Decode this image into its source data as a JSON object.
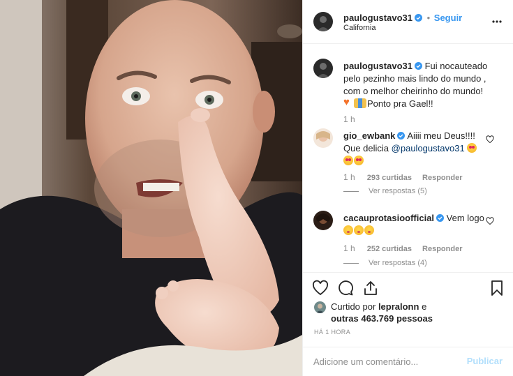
{
  "header": {
    "username": "paulogustavo31",
    "follow_label": "Seguir",
    "separator": "•",
    "location": "California"
  },
  "caption": {
    "username": "paulogustavo31",
    "text_1": "Fui nocauteado pelo pezinho mais lindo do mundo , com o melhor cheirinho do mundo!",
    "text_2": "Ponto pra Gael!!",
    "time": "1 h"
  },
  "comments": [
    {
      "username": "gio_ewbank",
      "text": "Aiiii meu Deus!!!! Que delicia",
      "mention": "@paulogustavo31",
      "time": "1 h",
      "likes": "293 curtidas",
      "reply": "Responder",
      "view_replies": "Ver respostas (5)"
    },
    {
      "username": "cacauprotasioofficial",
      "text": "Vem logo",
      "time": "1 h",
      "likes": "252 curtidas",
      "reply": "Responder",
      "view_replies": "Ver respostas (4)"
    }
  ],
  "likes": {
    "prefix": "Curtido por",
    "user": "lepralonn",
    "connector": "e",
    "others": "outras 463.769 pessoas"
  },
  "time_ago": "HÁ 1 HORA",
  "add_comment": {
    "placeholder": "Adicione um comentário...",
    "publish": "Publicar"
  },
  "icons": {
    "options": "more-options-icon",
    "like": "heart-icon",
    "comment": "comment-icon",
    "share": "share-icon",
    "save": "bookmark-icon",
    "verified": "verified-badge-icon"
  },
  "colors": {
    "accent": "#3897f0",
    "verified": "#3897f0",
    "text": "#262626",
    "muted": "#8e8e8e",
    "publish_disabled": "#b2dffc"
  }
}
